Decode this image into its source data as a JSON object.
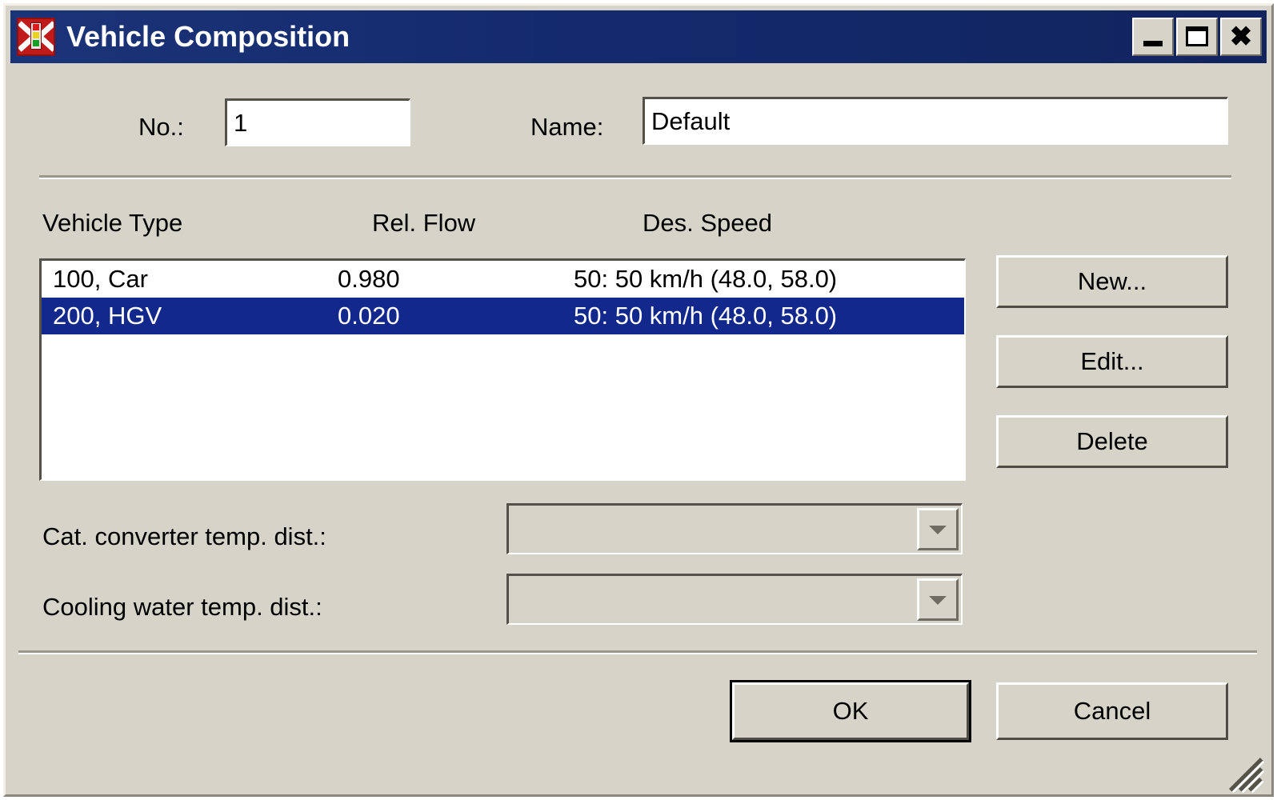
{
  "window": {
    "title": "Vehicle Composition",
    "icon": "vissim-traffic-light-icon",
    "controls": {
      "minimize": "minimize-icon",
      "maximize": "maximize-icon",
      "close": "close-icon"
    }
  },
  "form": {
    "no_label": "No.:",
    "no_value": "1",
    "name_label": "Name:",
    "name_value": "Default"
  },
  "list": {
    "headers": {
      "vehicle_type": "Vehicle Type",
      "rel_flow": "Rel. Flow",
      "des_speed": "Des. Speed"
    },
    "rows": [
      {
        "vehicle_type": "100, Car",
        "rel_flow": "0.980",
        "des_speed": "50: 50 km/h (48.0, 58.0)",
        "selected": false
      },
      {
        "vehicle_type": "200, HGV",
        "rel_flow": "0.020",
        "des_speed": "50: 50 km/h (48.0, 58.0)",
        "selected": true
      }
    ]
  },
  "side_buttons": {
    "new": "New...",
    "edit": "Edit...",
    "delete": "Delete"
  },
  "distributions": {
    "cat_converter_label": "Cat. converter temp. dist.:",
    "cat_converter_value": "",
    "cooling_water_label": "Cooling water temp. dist.:",
    "cooling_water_value": ""
  },
  "footer": {
    "ok": "OK",
    "cancel": "Cancel"
  },
  "colors": {
    "titlebar": "#132a6e",
    "selection": "#12288c",
    "face": "#d6d3c8",
    "field": "#ffffff",
    "text": "#000000"
  }
}
